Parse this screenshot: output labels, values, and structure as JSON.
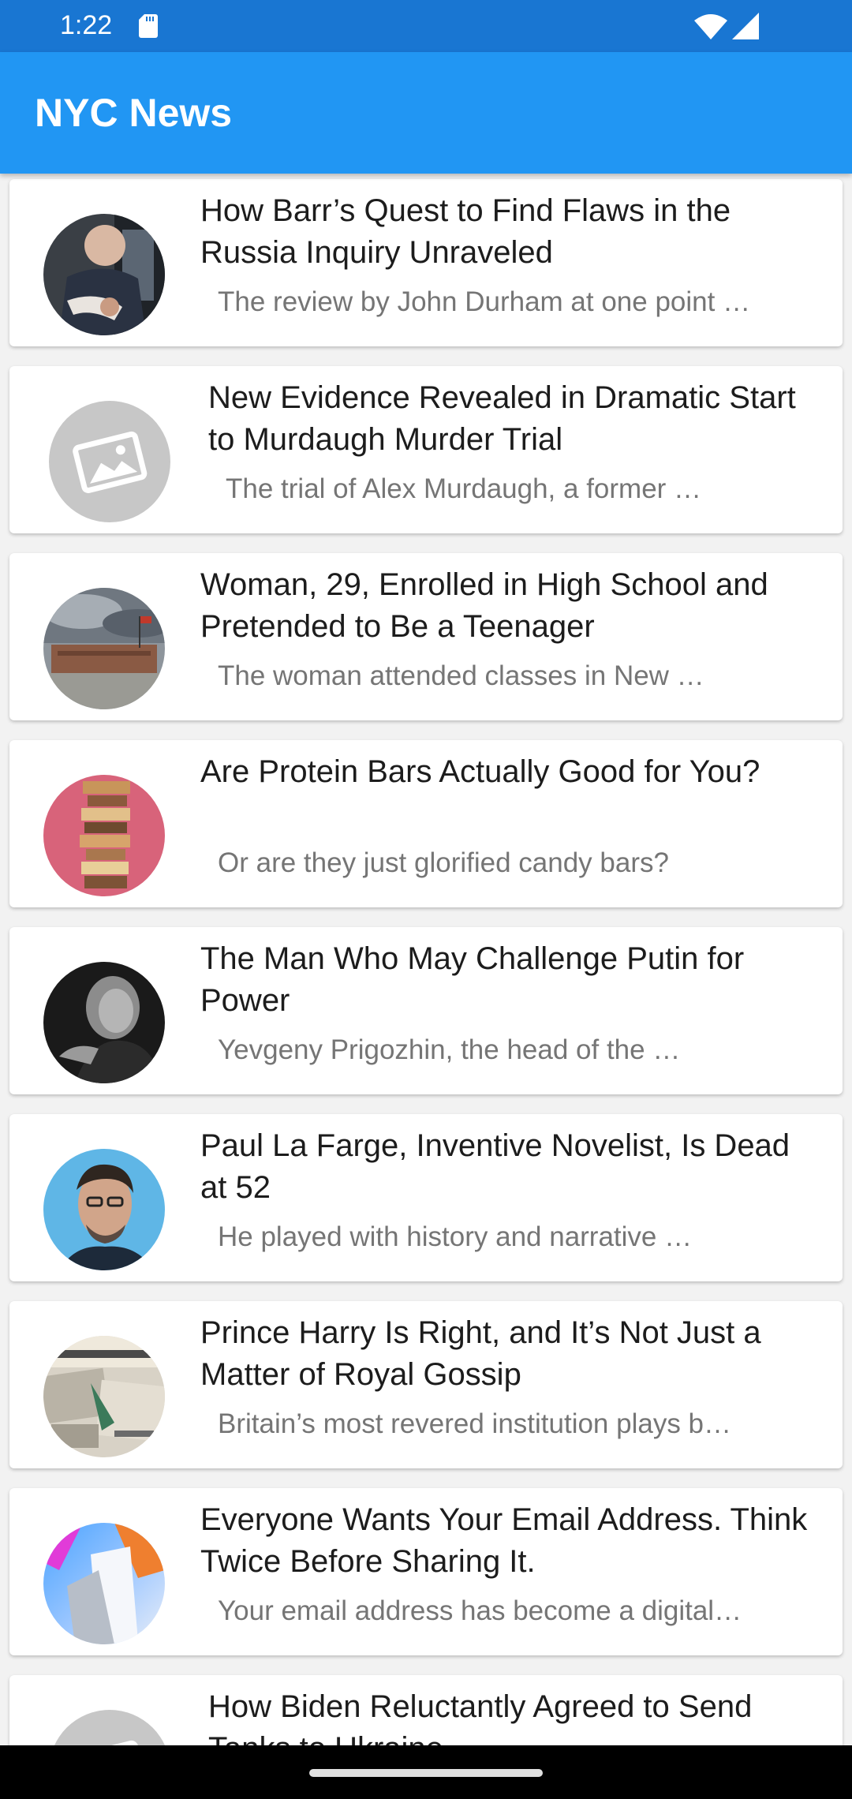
{
  "status_bar": {
    "time": "1:22"
  },
  "app_bar": {
    "title": "NYC News"
  },
  "articles": [
    {
      "title": "How Barr’s Quest to Find Flaws in the Russia Inquiry Unraveled",
      "summary": "The review by John Durham at one point …",
      "thumbnail": "photo-man-in-car"
    },
    {
      "title": "New Evidence Revealed in Dramatic Start to Murdaugh Murder Trial",
      "summary": "The trial of Alex Murdaugh, a former …",
      "thumbnail": "placeholder-image-icon"
    },
    {
      "title": "Woman, 29, Enrolled in High School and Pretended to Be a Teenager",
      "summary": "The woman attended classes in New …",
      "thumbnail": "photo-school-building"
    },
    {
      "title": "Are Protein Bars Actually Good for You?",
      "summary": "Or are they just glorified candy bars?",
      "thumbnail": "photo-protein-bar-stack"
    },
    {
      "title": "The Man Who May Challenge Putin for Power",
      "summary": "Yevgeny Prigozhin, the head of the …",
      "thumbnail": "photo-bw-portrait"
    },
    {
      "title": "Paul La Farge, Inventive Novelist, Is Dead at 52",
      "summary": "He played with history and narrative …",
      "thumbnail": "photo-man-portrait"
    },
    {
      "title": "Prince Harry Is Right, and It’s Not Just a Matter of Royal Gossip",
      "summary": "Britain’s most revered institution plays b…",
      "thumbnail": "photo-newspapers"
    },
    {
      "title": "Everyone Wants Your Email Address. Think Twice Before Sharing It.",
      "summary": "Your email address has become a digital…",
      "thumbnail": "illustration-abstract"
    },
    {
      "title": "How Biden Reluctantly Agreed to Send Tanks to Ukraine",
      "summary": "",
      "thumbnail": "placeholder-image-icon"
    }
  ],
  "colors": {
    "status_bar": "#1976d2",
    "app_bar": "#2196f3",
    "background": "#f2f2f2",
    "card": "#ffffff",
    "title_text": "#1c1c1c",
    "summary_text": "#757575"
  }
}
